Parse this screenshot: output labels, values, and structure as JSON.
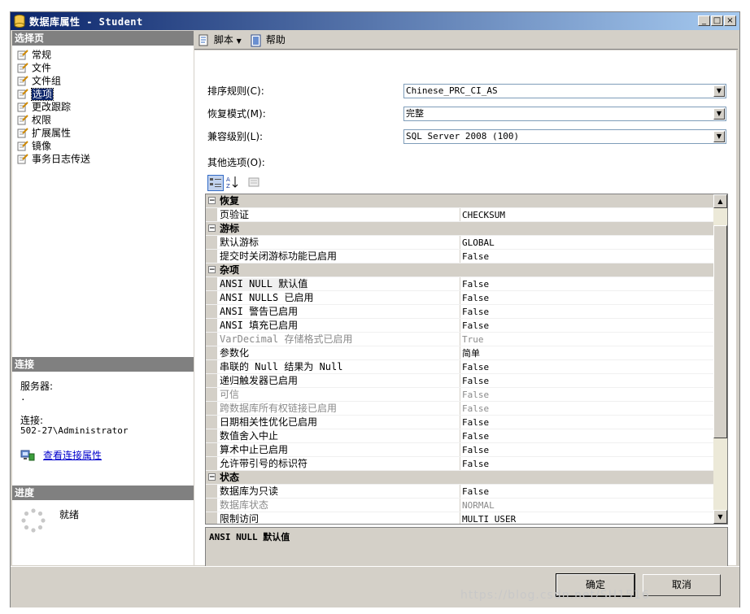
{
  "window": {
    "title": "数据库属性 - Student",
    "buttons": [
      "_",
      "□",
      "×"
    ]
  },
  "left": {
    "select_page_header": "选择页",
    "nav_items": [
      {
        "label": "常规",
        "icon": "wrench-page-icon"
      },
      {
        "label": "文件",
        "icon": "wrench-page-icon"
      },
      {
        "label": "文件组",
        "icon": "wrench-page-icon"
      },
      {
        "label": "选项",
        "icon": "wrench-page-icon",
        "selected": true
      },
      {
        "label": "更改跟踪",
        "icon": "wrench-page-icon"
      },
      {
        "label": "权限",
        "icon": "wrench-page-icon"
      },
      {
        "label": "扩展属性",
        "icon": "wrench-page-icon"
      },
      {
        "label": "镜像",
        "icon": "wrench-page-icon"
      },
      {
        "label": "事务日志传送",
        "icon": "wrench-page-icon"
      }
    ],
    "connection_header": "连接",
    "server_label": "服务器:",
    "server_value": ".",
    "connection_label": "连接:",
    "connection_value": "502-27\\Administrator",
    "view_connection_link": "查看连接属性",
    "progress_header": "进度",
    "progress_status": "就绪"
  },
  "toolbar": {
    "script_label": "脚本",
    "help_label": "帮助"
  },
  "form": {
    "collation_label": "排序规则(C):",
    "collation_value": "Chinese_PRC_CI_AS",
    "recovery_label": "恢复模式(M):",
    "recovery_value": "完整",
    "compat_label": "兼容级别(L):",
    "compat_value": "SQL Server 2008 (100)",
    "other_options_label": "其他选项(O):"
  },
  "grid": {
    "rows": [
      {
        "type": "cat",
        "name": "恢复"
      },
      {
        "type": "prop",
        "name": "页验证",
        "value": "CHECKSUM"
      },
      {
        "type": "cat",
        "name": "游标"
      },
      {
        "type": "prop",
        "name": "默认游标",
        "value": "GLOBAL"
      },
      {
        "type": "prop",
        "name": "提交时关闭游标功能已启用",
        "value": "False"
      },
      {
        "type": "cat",
        "name": "杂项"
      },
      {
        "type": "prop",
        "name": "ANSI NULL 默认值",
        "value": "False",
        "highlight": true
      },
      {
        "type": "prop",
        "name": "ANSI NULLS 已启用",
        "value": "False"
      },
      {
        "type": "prop",
        "name": "ANSI 警告已启用",
        "value": "False"
      },
      {
        "type": "prop",
        "name": "ANSI 填充已启用",
        "value": "False"
      },
      {
        "type": "prop",
        "name": "VarDecimal 存储格式已启用",
        "value": "True",
        "disabled": true
      },
      {
        "type": "prop",
        "name": "参数化",
        "value": "简单"
      },
      {
        "type": "prop",
        "name": "串联的 Null 结果为 Null",
        "value": "False"
      },
      {
        "type": "prop",
        "name": "递归触发器已启用",
        "value": "False"
      },
      {
        "type": "prop",
        "name": "可信",
        "value": "False",
        "disabled": true
      },
      {
        "type": "prop",
        "name": "跨数据库所有权链接已启用",
        "value": "False",
        "disabled": true
      },
      {
        "type": "prop",
        "name": "日期相关性优化已启用",
        "value": "False"
      },
      {
        "type": "prop",
        "name": "数值舍入中止",
        "value": "False"
      },
      {
        "type": "prop",
        "name": "算术中止已启用",
        "value": "False"
      },
      {
        "type": "prop",
        "name": "允许带引号的标识符",
        "value": "False"
      },
      {
        "type": "cat",
        "name": "状态"
      },
      {
        "type": "prop",
        "name": "数据库为只读",
        "value": "False"
      },
      {
        "type": "prop",
        "name": "数据库状态",
        "value": "NORMAL",
        "disabled": true
      },
      {
        "type": "prop",
        "name": "限制访问",
        "value": "MULTI_USER"
      }
    ]
  },
  "description": {
    "title": "ANSI NULL 默认值"
  },
  "buttons": {
    "ok": "确定",
    "cancel": "取消"
  },
  "watermark": "https://blog.csdn.net/SH1516"
}
